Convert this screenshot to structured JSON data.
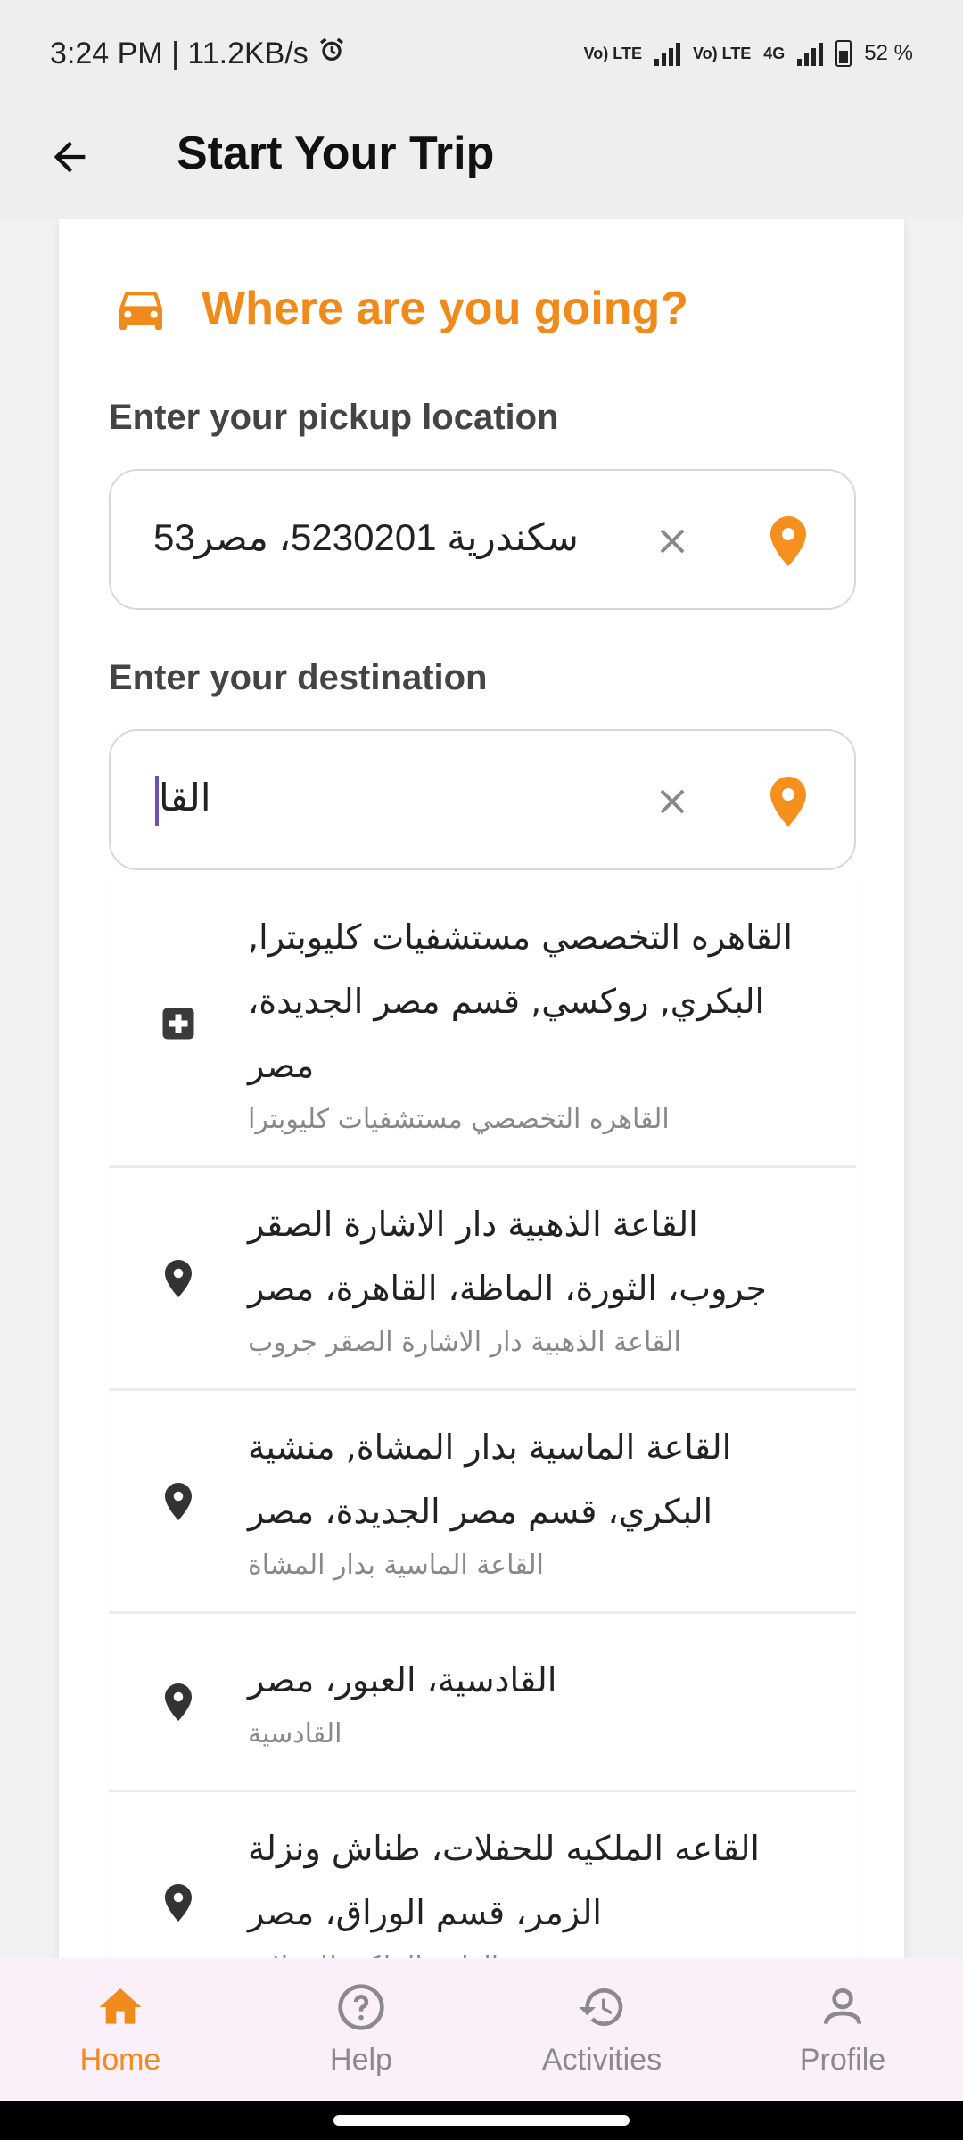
{
  "status_bar": {
    "time_speed": "3:24 PM | 11.2KB/s",
    "net1": "Vo) LTE",
    "net2": "Vo) LTE",
    "net3": "4G",
    "battery": "52 %"
  },
  "header": {
    "title": "Start Your Trip"
  },
  "card": {
    "title": "Where are you going?",
    "pickup_label": "Enter your pickup location",
    "pickup_value": "سكندرية 5230201، مصر53",
    "destination_label": "Enter your destination",
    "destination_value": "القا"
  },
  "suggestions": [
    {
      "icon": "hospital-icon",
      "main": "القاهره التخصصي مستشفيات كليوبترا, البكري, روكسي, قسم مصر الجديدة، مصر",
      "sub": "القاهره التخصصي مستشفيات كليوبترا"
    },
    {
      "icon": "location-pin-icon",
      "main": "القاعة الذهبية دار الاشارة الصقر جروب، الثورة، الماظة، القاهرة، مصر",
      "sub": "القاعة الذهبية دار الاشارة الصقر جروب"
    },
    {
      "icon": "location-pin-icon",
      "main": "القاعة الماسية بدار المشاة, منشية البكري، قسم مصر الجديدة، مصر",
      "sub": "القاعة الماسية بدار المشاة"
    },
    {
      "icon": "location-pin-icon",
      "main": "القادسية، العبور، مصر",
      "sub": "القادسية"
    },
    {
      "icon": "location-pin-icon",
      "main": "القاعه الملكيه للحفلات، طناش ونزلة الزمر، قسم الوراق، مصر",
      "sub": "القاعه الملكيه للحفلات"
    }
  ],
  "bottom_nav": [
    {
      "label": "Home",
      "icon": "home-icon",
      "active": true
    },
    {
      "label": "Help",
      "icon": "help-icon",
      "active": false
    },
    {
      "label": "Activities",
      "icon": "history-icon",
      "active": false
    },
    {
      "label": "Profile",
      "icon": "profile-icon",
      "active": false
    }
  ],
  "colors": {
    "accent": "#f08a1b",
    "caret": "#6b4fbb",
    "nav_bg": "#fbeffa"
  }
}
